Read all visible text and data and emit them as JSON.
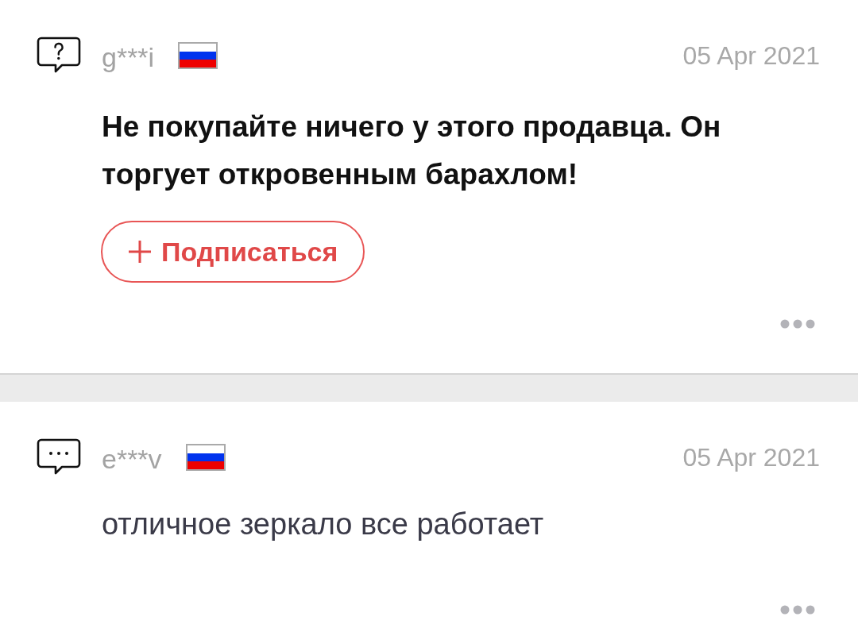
{
  "reviews": [
    {
      "kind": "question",
      "user": "g***i",
      "date": "05 Apr 2021",
      "bold": true,
      "text": "Не покупайте ничего у этого продавца. Он торгует откровенным барахлом!",
      "follow_button": {
        "label": "Подписаться"
      }
    },
    {
      "kind": "comment",
      "user": "e***v",
      "date": "05 Apr 2021",
      "bold": false,
      "text": "отличное зеркало все работает"
    }
  ]
}
